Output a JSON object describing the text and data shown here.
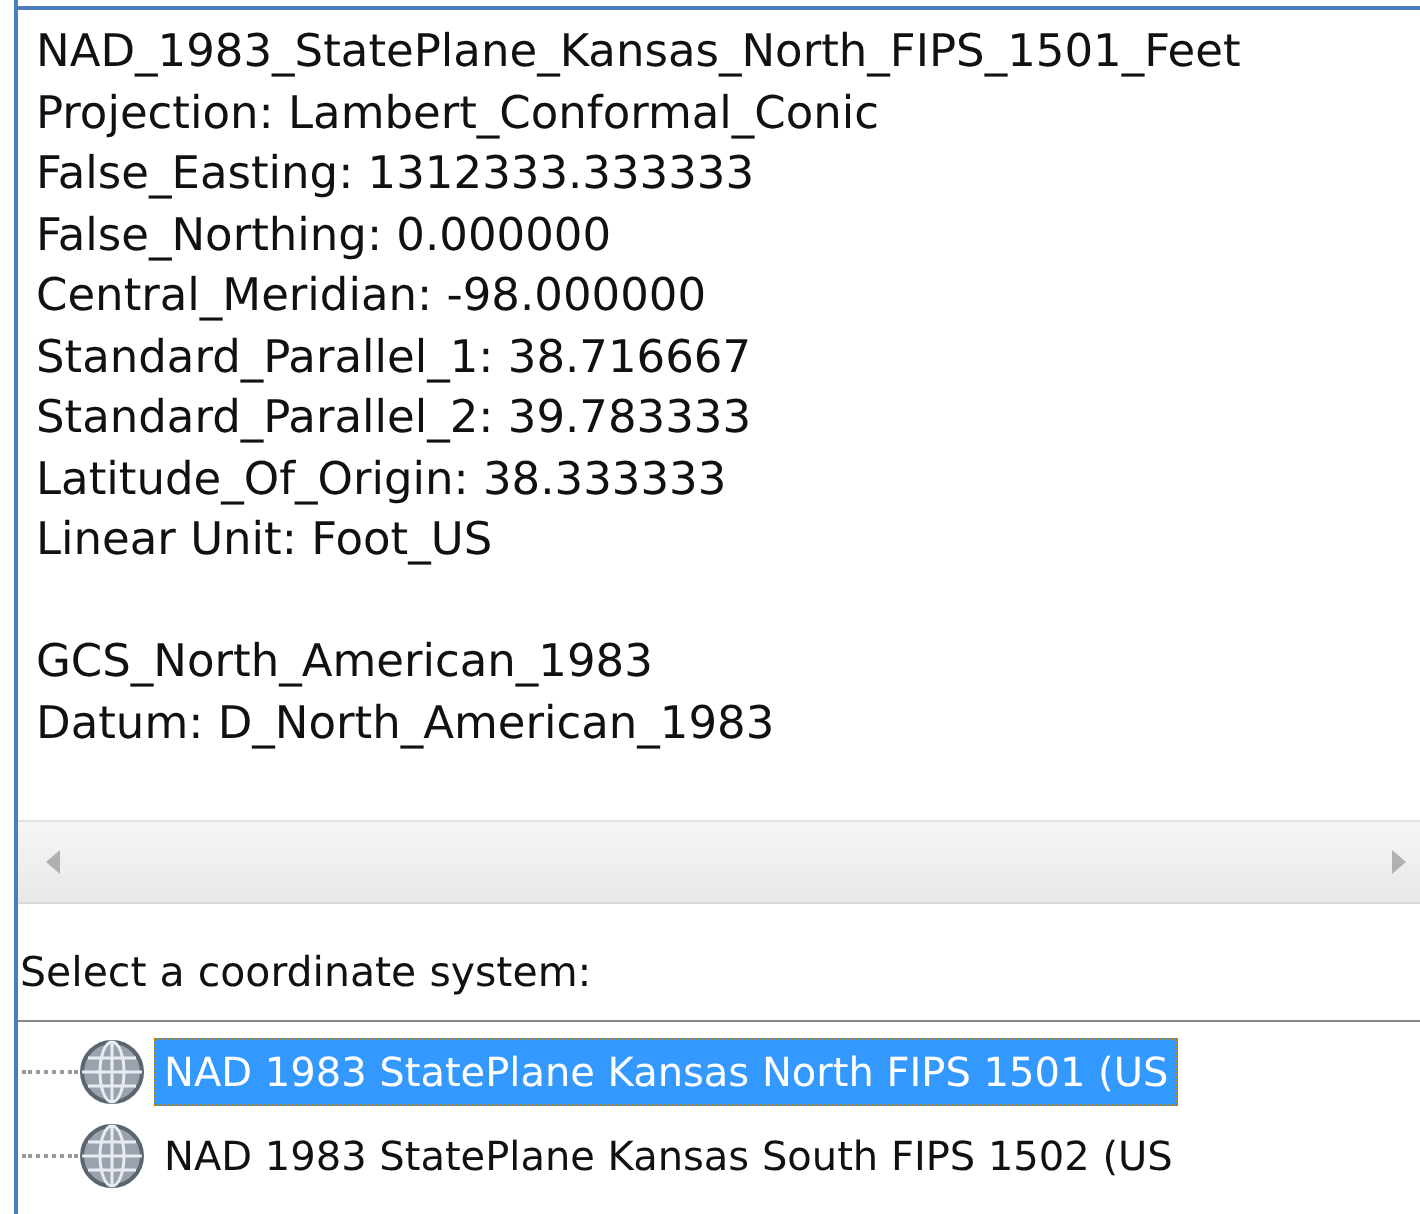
{
  "details": {
    "groups": [
      [
        "NAD_1983_StatePlane_Kansas_North_FIPS_1501_Feet",
        "Projection: Lambert_Conformal_Conic",
        "False_Easting: 1312333.333333",
        "False_Northing: 0.000000",
        "Central_Meridian: -98.000000",
        "Standard_Parallel_1: 38.716667",
        "Standard_Parallel_2: 39.783333",
        "Latitude_Of_Origin: 38.333333",
        "Linear Unit: Foot_US"
      ],
      [
        "GCS_North_American_1983",
        "Datum: D_North_American_1983"
      ]
    ]
  },
  "prompt": "Select a coordinate system:",
  "tree": {
    "items": [
      {
        "label": "NAD 1983 StatePlane Kansas North FIPS 1501 (US",
        "selected": true
      },
      {
        "label": "NAD 1983 StatePlane Kansas South FIPS 1502 (US",
        "selected": false
      }
    ]
  }
}
